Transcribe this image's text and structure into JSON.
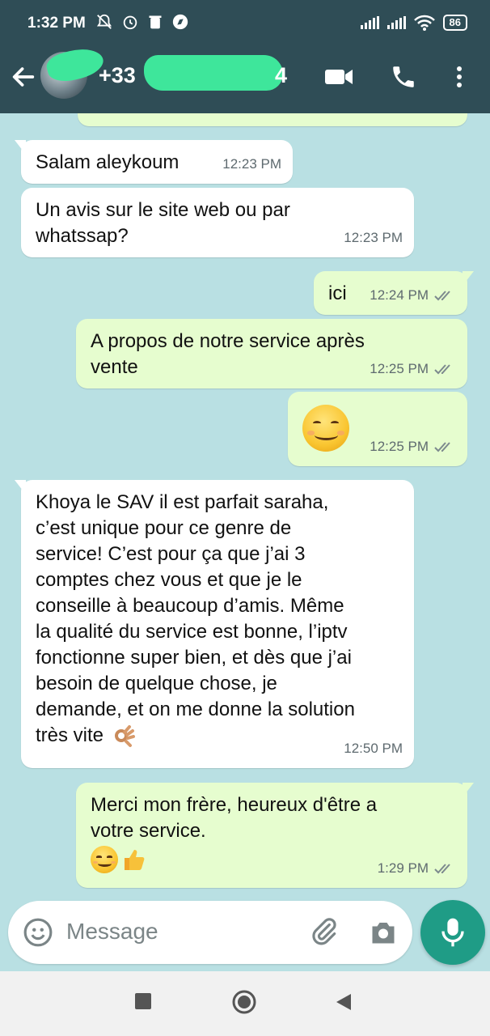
{
  "status_bar": {
    "time": "1:32 PM",
    "battery": "86"
  },
  "header": {
    "contact_prefix": "+33",
    "contact_suffix": "4"
  },
  "messages": [
    {
      "side": "in",
      "text": "Salam aleykoum",
      "time": "12:23 PM"
    },
    {
      "side": "in",
      "text": "Un avis sur le site web ou par\nwhatssap?",
      "time": "12:23 PM"
    },
    {
      "side": "out",
      "text": "ici",
      "time": "12:24 PM"
    },
    {
      "side": "out",
      "text": "A propos de notre service après\nvente",
      "time": "12:25 PM"
    },
    {
      "side": "out",
      "text": "",
      "emoji": "smiling-face",
      "time": "12:25 PM"
    },
    {
      "side": "in",
      "text": "Khoya le SAV il est parfait saraha,\nc’est unique pour ce genre de\nservice! C’est pour ça que j’ai 3\ncomptes chez vous et que je le\nconseille à beaucoup d’amis. Même\nla qualité du service est bonne, l’iptv\nfonctionne super bien, et dès que j’ai\nbesoin de quelque chose, je\ndemande, et on me donne la solution\ntrès vite",
      "emoji_trailing": "ok-hand",
      "time": "12:50 PM"
    },
    {
      "side": "out",
      "text": "Merci mon frère, heureux d'être a\nvotre service.",
      "emoji_line": [
        "smiling-face",
        "thumbs-up"
      ],
      "time": "1:29 PM"
    }
  ],
  "input": {
    "placeholder": "Message"
  },
  "colors": {
    "header": "#2f4d56",
    "chat_bg": "#b9e0e3",
    "incoming": "#ffffff",
    "outgoing": "#e6fdcf",
    "accent": "#1f9c86"
  }
}
